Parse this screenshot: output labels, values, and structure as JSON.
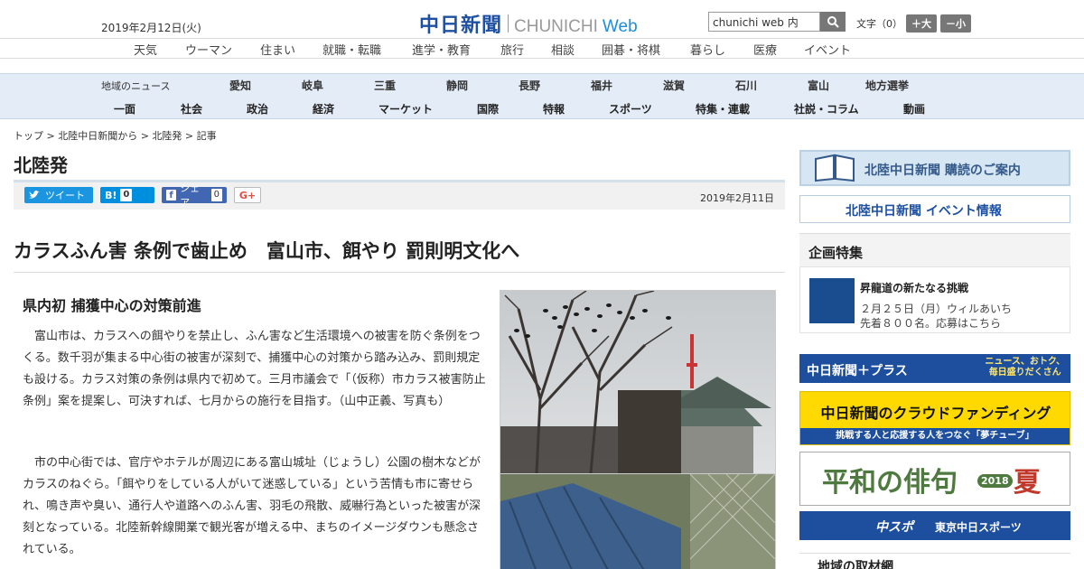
{
  "header": {
    "date": "2019年2月12日(火)",
    "logo_jp": "中日新聞",
    "logo_en": "CHUNICHI",
    "logo_web": "Web",
    "search_value": "chunichi web 内",
    "font_label": "文字（0）",
    "font_larger": "＋大",
    "font_smaller": "－小"
  },
  "topnav": [
    "天気",
    "ウーマン",
    "住まい",
    "就職・転職",
    "進学・教育",
    "旅行",
    "相談",
    "囲碁・将棋",
    "暮らし",
    "医療",
    "イベント"
  ],
  "region": {
    "label": "地域のニュース",
    "items": [
      "愛知",
      "岐阜",
      "三重",
      "静岡",
      "長野",
      "福井",
      "滋賀",
      "石川",
      "富山",
      "地方選挙"
    ]
  },
  "categories": [
    "一面",
    "社会",
    "政治",
    "経済",
    "マーケット",
    "国際",
    "特報",
    "スポーツ",
    "特集・連載",
    "社説・コラム",
    "動画"
  ],
  "breadcrumb": "トップ > 北陸中日新聞から > 北陸発 > 記事",
  "section_title": "北陸発",
  "share": {
    "twitter": "ツイート",
    "hatena": "B!",
    "hatena_count": "0",
    "facebook": "シェア",
    "facebook_count": "0",
    "gplus": "G+"
  },
  "article": {
    "date": "2019年2月11日",
    "headline": "カラスふん害 条例で歯止め　富山市、餌やり 罰則明文化へ",
    "subhead": "県内初 捕獲中心の対策前進",
    "p1": "　富山市は、カラスへの餌やりを禁止し、ふん害など生活環境への被害を防ぐ条例をつくる。数千羽が集まる中心街の被害が深刻で、捕獲中心の対策から踏み込み、罰則規定も設ける。カラス対策の条例は県内で初めて。三月市議会で「（仮称）市カラス被害防止条例」案を提案し、可決すれば、七月からの施行を目指す。（山中正義、写真も）",
    "p2": "　市の中心街では、官庁やホテルが周辺にある富山城址（じょうし）公園の樹木などがカラスのねぐら。「餌やりをしている人がいて迷惑している」という苦情も市に寄せられ、鳴き声や臭い、通行人や道路へのふん害、羽毛の飛散、威嚇行為といった被害が深刻となっている。北陸新幹線開業で観光客が増える中、まちのイメージダウンも懸念されている。"
  },
  "sidebar": {
    "subscribe": "北陸中日新聞 購読のご案内",
    "event": "北陸中日新聞 イベント情報",
    "feature_title": "企画特集",
    "feature_head": "昇龍道の新たなる挑戦",
    "feature_desc1": "２月２５日（月）ウィルあいち",
    "feature_desc2": "先着８００名。応募はこちら",
    "plus_title": "中日新聞＋プラス",
    "plus_sub1": "ニュース、おトク、",
    "plus_sub2": "毎日盛りだくさん",
    "cf_title": "中日新聞のクラウドファンディング",
    "cf_band": "挑戦する人と応援する人をつなぐ「夢チューブ」",
    "haiku_title": "平和の俳句",
    "haiku_year": "2018",
    "haiku_season": "夏",
    "chuspo": "中スポ",
    "chuspo2": "東京中日スポーツ",
    "local": "地域の取材網"
  }
}
